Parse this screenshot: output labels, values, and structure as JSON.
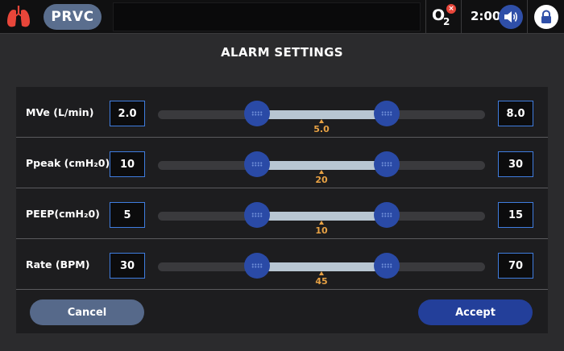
{
  "header": {
    "mode": "PRVC",
    "o2_label": "O",
    "o2_sub": "2",
    "o2_alert": "×",
    "time": "2:00",
    "icons": [
      "lungs-icon",
      "o2-alert-icon",
      "speaker-icon",
      "lock-icon"
    ],
    "colors": {
      "lungs": "#e8463a",
      "mode_button": "#5a6e8e",
      "speaker_button": "#2f4fa8"
    }
  },
  "title": "ALARM SETTINGS",
  "alarms": [
    {
      "label": "MVe (L/min)",
      "min": "2.0",
      "max": "8.0",
      "current": "5.0"
    },
    {
      "label": "Ppeak (cmH₂0)",
      "min": "10",
      "max": "30",
      "current": "20"
    },
    {
      "label": "PEEP(cmH₂0)",
      "min": "5",
      "max": "15",
      "current": "10"
    },
    {
      "label": "Rate (BPM)",
      "min": "30",
      "max": "70",
      "current": "45"
    }
  ],
  "actions": {
    "cancel_label": "Cancel",
    "accept_label": "Accept"
  },
  "colors": {
    "accent": "#3f7de0",
    "marker": "#e8a244",
    "thumb": "#2a4aa6",
    "accept_button": "#233f9a",
    "cancel_button": "#56698a"
  }
}
